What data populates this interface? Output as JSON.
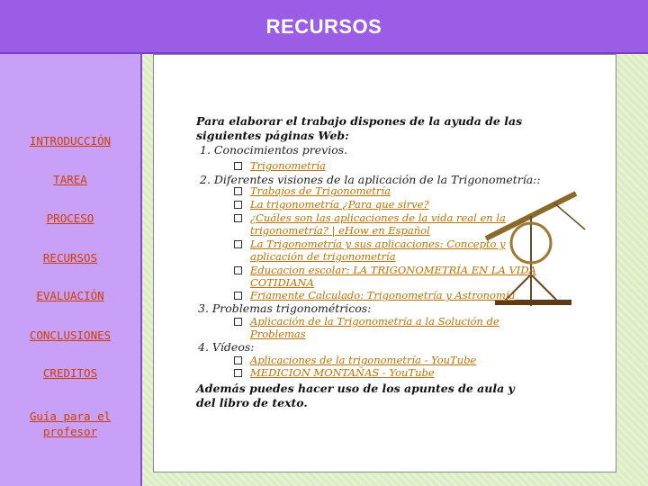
{
  "header": {
    "title": "RECURSOS"
  },
  "nav": [
    {
      "label": "INTRODUCCIÓN"
    },
    {
      "label": "TAREA"
    },
    {
      "label": "PROCESO"
    },
    {
      "label": "RECURSOS"
    },
    {
      "label": "EVALUACIÓN"
    },
    {
      "label": "CONCLUSIONES"
    },
    {
      "label": "CREDITOS"
    },
    {
      "label": "Guía para el"
    },
    {
      "label": "profesor"
    }
  ],
  "content": {
    "intro_1": "Para elaborar el trabajo dispones de la ayuda de las",
    "intro_2": "siguientes páginas Web:",
    "sections": [
      {
        "heading": "1.   Conocimientos previos."
      },
      {
        "heading": "2.  Diferentes visiones de la aplicación de la  Trigonometría::"
      },
      {
        "heading": "3. Problemas trigonométricos:"
      },
      {
        "heading": "4. Vídeos:"
      }
    ],
    "links": [
      "Trigonometría",
      "Trabajos de Trigonometría",
      "La trigonometría ¿Para que sirve?",
      "¿Cuáles son las aplicaciones de la vida real en la",
      "trigonometría? | eHow en Español",
      "La Trigonometría y sus aplicaciones: Concepto y",
      "aplicación de trigonometría",
      "Educacion escolar: LA TRIGONOMETRÍA EN LA VIDA",
      "COTIDIANA",
      "Friamente Calculado: Trigonometría y Astronomía",
      "Aplicación de la Trigonometría a la Solución de",
      "Problemas",
      "Aplicaciones de la trigonometría - YouTube",
      "MEDICION MONTAÑAS - YouTube"
    ],
    "closing_1": "Además puedes hacer uso de  los apuntes de aula y",
    "closing_2": "del libro de texto."
  },
  "colors": {
    "header": "#9b5ce6",
    "sidebar": "#c8a0f8",
    "nav_text": "#cc3f00",
    "link": "#c07000",
    "content_bg": "#ddecc4"
  }
}
